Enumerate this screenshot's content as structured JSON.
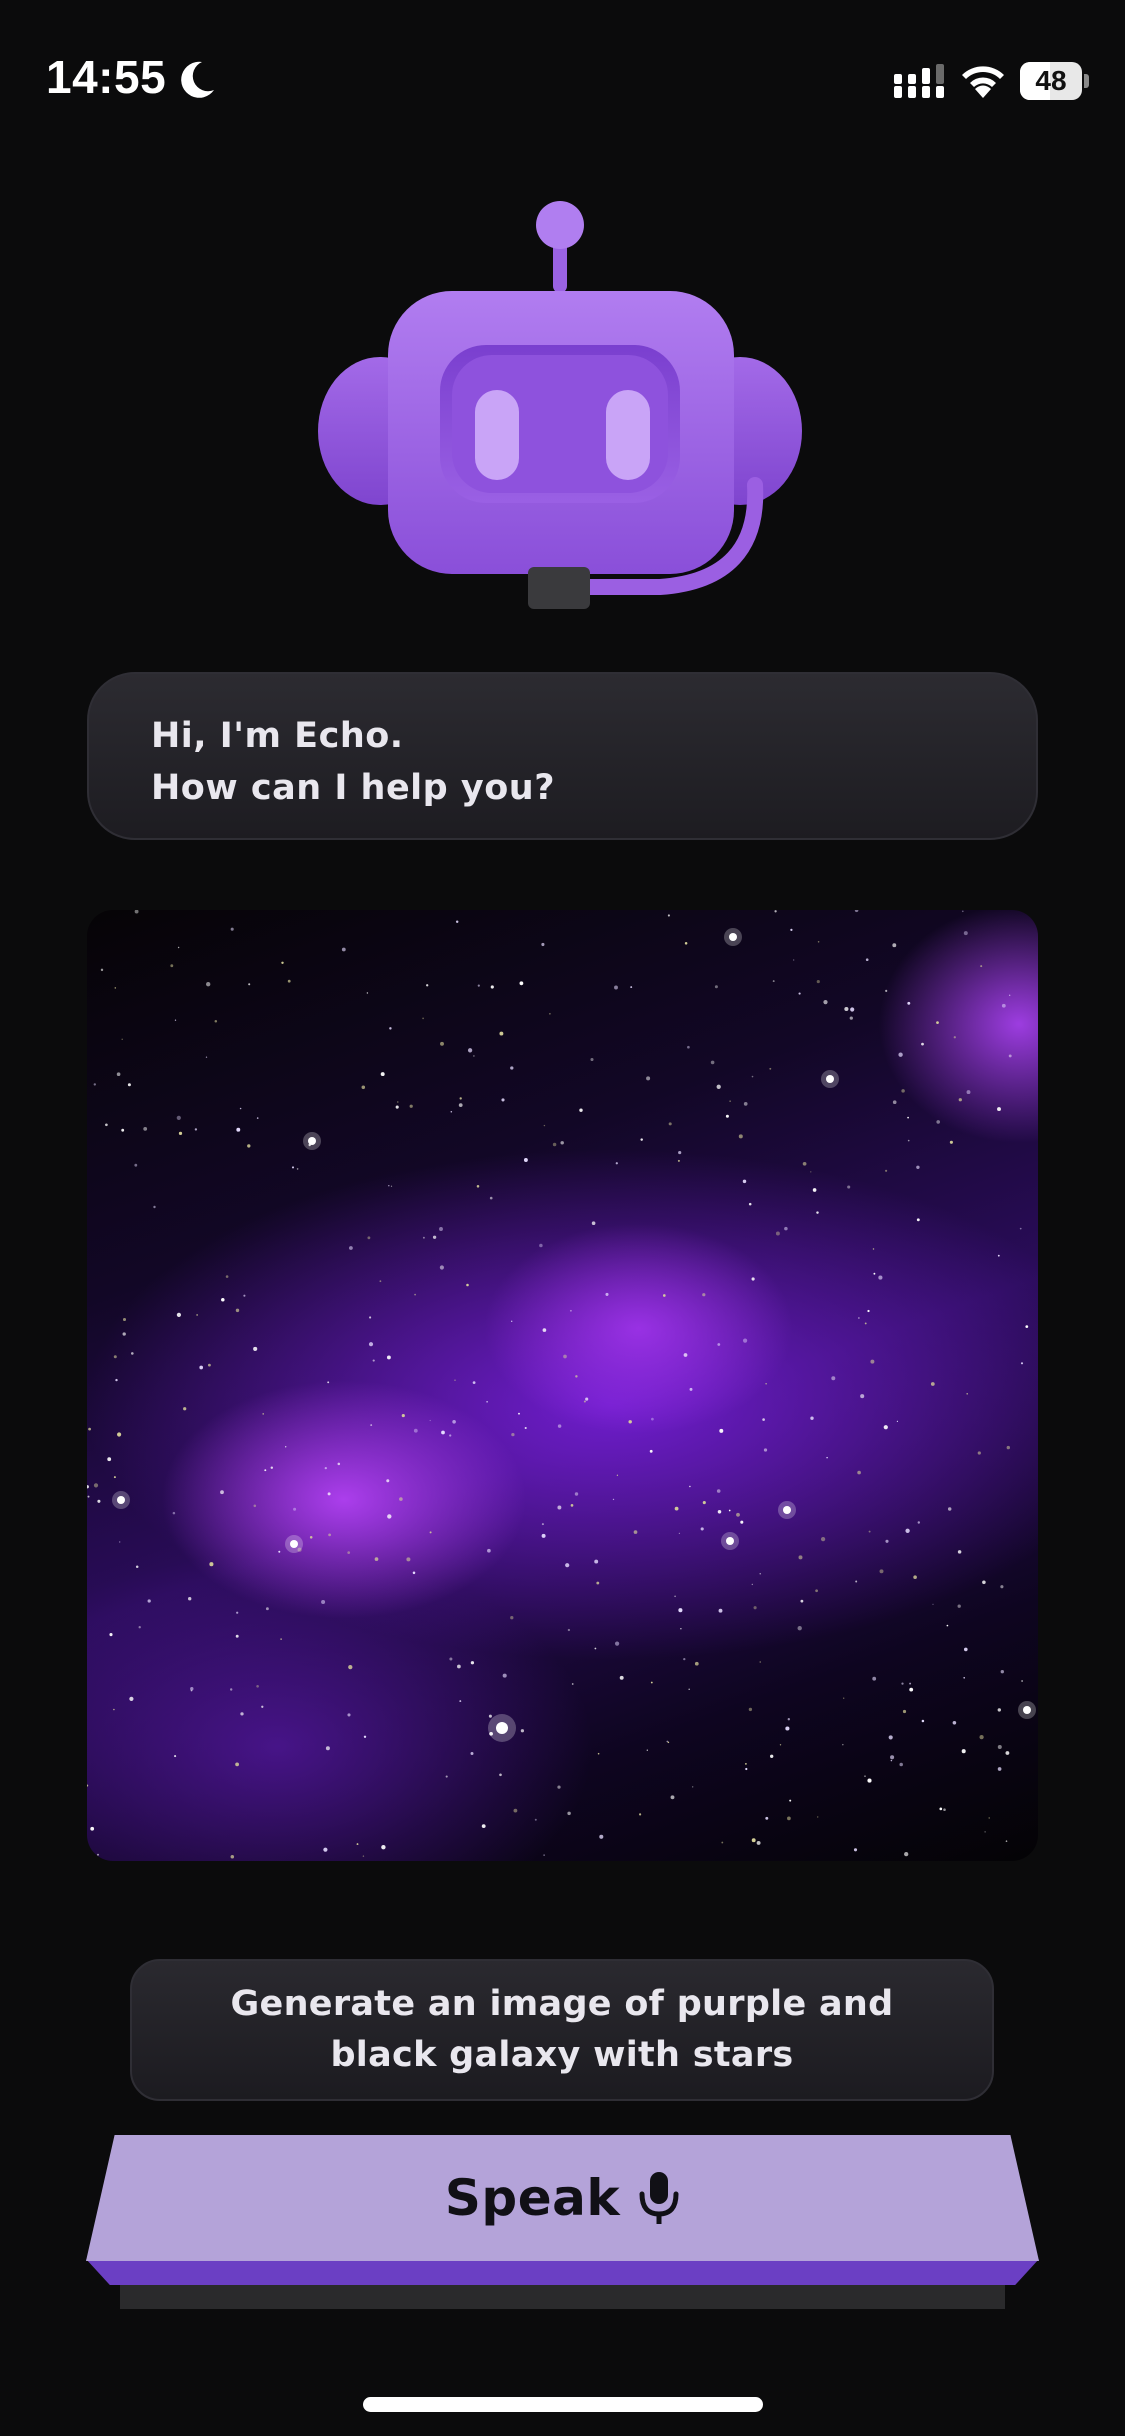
{
  "status_bar": {
    "time": "14:55",
    "battery_level": "48",
    "battery_fraction": 0.48,
    "icons": [
      "moon-icon",
      "cellular-signal-icon",
      "wifi-icon",
      "battery-icon"
    ]
  },
  "assistant": {
    "avatar_icon": "robot-mascot-icon",
    "greeting_line1": "Hi, I'm Echo.",
    "greeting_line2": "How can I help you?"
  },
  "generated_image": {
    "subject": "purple-galaxy-image"
  },
  "prompt": {
    "text": "Generate an image of purple and black galaxy with stars"
  },
  "speak_button": {
    "label": "Speak",
    "icon": "microphone-icon"
  },
  "colors": {
    "background": "#0b0b0c",
    "accent_purple": "#b4a3d9",
    "accent_purple_dark": "#6b3fc4",
    "bubble": "#26252b",
    "text": "#e9e7ee"
  }
}
